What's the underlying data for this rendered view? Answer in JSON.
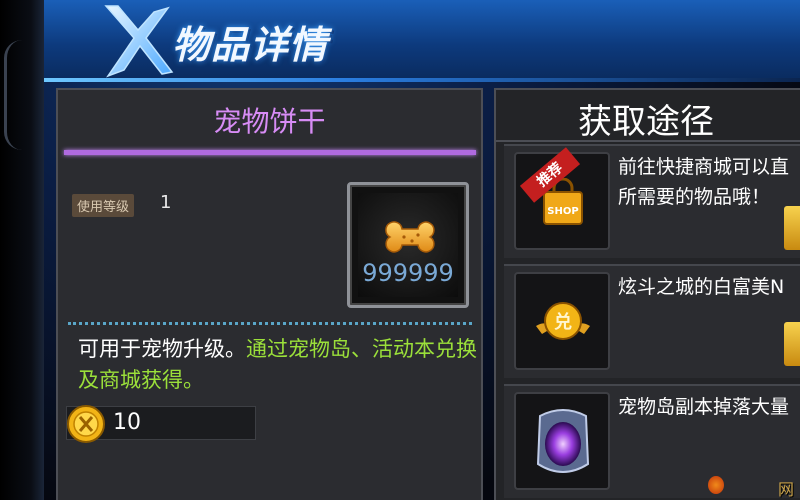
{
  "header": {
    "title": "物品详情"
  },
  "item": {
    "name": "宠物饼干",
    "level_label": "使用等级",
    "level_value": "1",
    "count": "999999",
    "desc_white": "可用于宠物升级。",
    "desc_green": "通过宠物岛、活动本兑换及商城获得。",
    "price": "10",
    "icon": "bone-biscuit-icon"
  },
  "sources": {
    "title": "获取途径",
    "items": [
      {
        "text_line1": "前往快捷商城可以直",
        "text_line2": "所需要的物品哦！",
        "tag": "推荐",
        "icon": "shop-bag-icon"
      },
      {
        "text_line1": "炫斗之城的白富美N",
        "text_line2": "",
        "tag": "",
        "icon": "exchange-coin-icon"
      },
      {
        "text_line1": "宠物岛副本掉落大量",
        "text_line2": "",
        "tag": "",
        "icon": "portal-icon"
      }
    ]
  },
  "colors": {
    "item_name": "#d78cf5",
    "highlight_text": "#9be03a",
    "count": "#7aa9d6"
  },
  "watermark": "网"
}
